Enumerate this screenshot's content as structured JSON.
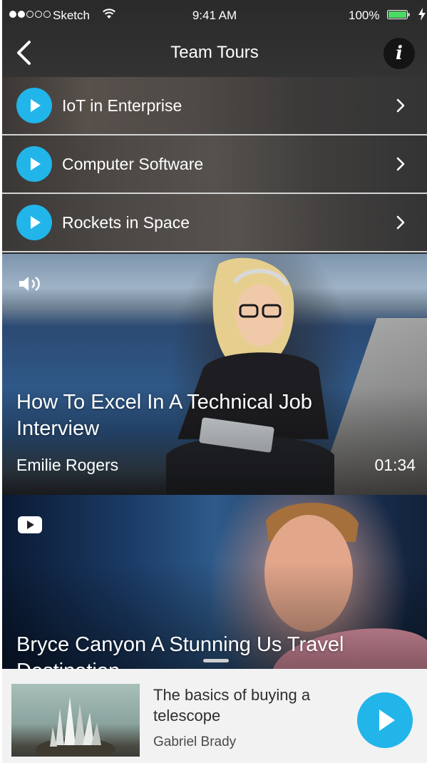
{
  "status_bar": {
    "carrier": "Sketch",
    "time": "9:41 AM",
    "battery_percent": "100%",
    "signal_bars_filled": 2,
    "signal_bars_total": 5,
    "battery_level": 1.0
  },
  "nav": {
    "title": "Team Tours",
    "back_icon": "chevron-left-icon",
    "info_label": "i"
  },
  "tours": [
    {
      "label": "IoT in Enterprise"
    },
    {
      "label": "Computer Software"
    },
    {
      "label": "Rockets in Space"
    }
  ],
  "videos": [
    {
      "title": "How To Excel In A Technical Job Interview",
      "author": "Emilie Rogers",
      "duration": "01:34",
      "media_icon": "speaker-icon"
    },
    {
      "title": "Bryce Canyon A Stunning Us Travel Destination",
      "media_icon": "youtube-icon"
    }
  ],
  "now_playing": {
    "title": "The basics of buying a telescope",
    "author": "Gabriel Brady"
  },
  "colors": {
    "accent": "#21b5ea",
    "header_background": "#2d2d2d",
    "mini_player_background": "#f2f2f2",
    "battery_fill": "#4cd964"
  }
}
